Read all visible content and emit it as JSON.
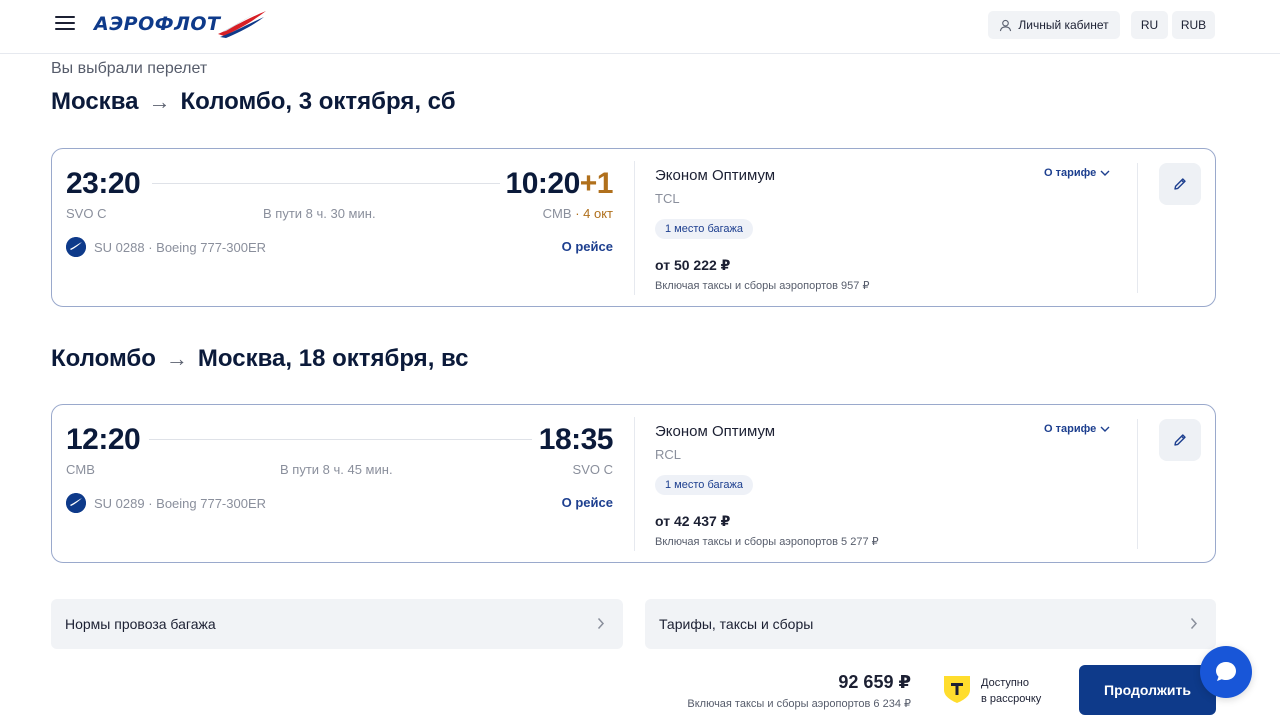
{
  "header": {
    "logo_text": "АЭРОФЛОТ",
    "cabinet_label": "Личный кабинет",
    "language": "RU",
    "currency": "RUB"
  },
  "page": {
    "chosen_label": "Вы выбрали перелет"
  },
  "outbound": {
    "route_from": "Москва",
    "route_to": "Коломбо, 3 октября, сб",
    "dep_time": "23:20",
    "arr_time": "10:20",
    "arr_plus": "+1",
    "dep_code": "SVO C",
    "arr_code": "CMB",
    "arr_date": "· 4 окт",
    "duration": "В пути 8 ч. 30 мин.",
    "flight_no": "SU 0288 · Boeing 777-300ER",
    "about_flight": "О рейсе",
    "fare_name": "Эконом Оптимум",
    "fare_code": "TCL",
    "about_fare": "О тарифе",
    "baggage": "1 место багажа",
    "price": "от 50 222 ₽",
    "taxes": "Включая таксы и сборы аэропортов 957 ₽"
  },
  "inbound": {
    "route_from": "Коломбо",
    "route_to": "Москва, 18 октября, вс",
    "dep_time": "12:20",
    "arr_time": "18:35",
    "dep_code": "CMB",
    "arr_code": "SVO C",
    "duration": "В пути 8 ч. 45 мин.",
    "flight_no": "SU 0289 · Boeing 777-300ER",
    "about_flight": "О рейсе",
    "fare_name": "Эконом Оптимум",
    "fare_code": "RCL",
    "about_fare": "О тарифе",
    "baggage": "1 место багажа",
    "price": "от 42 437 ₽",
    "taxes": "Включая таксы и сборы аэропортов 5 277 ₽"
  },
  "info": {
    "baggage_rules": "Нормы провоза багажа",
    "fares_taxes": "Тарифы, таксы и сборы"
  },
  "summary": {
    "total": "92 659 ₽",
    "total_taxes": "Включая таксы и сборы аэропортов 6 234 ₽",
    "installment_line1": "Доступно",
    "installment_line2": "в рассрочку",
    "continue_label": "Продолжить"
  },
  "colors": {
    "brand_blue": "#0e3a8a",
    "accent_orange": "#b0701c",
    "chat_blue": "#1856d8"
  }
}
